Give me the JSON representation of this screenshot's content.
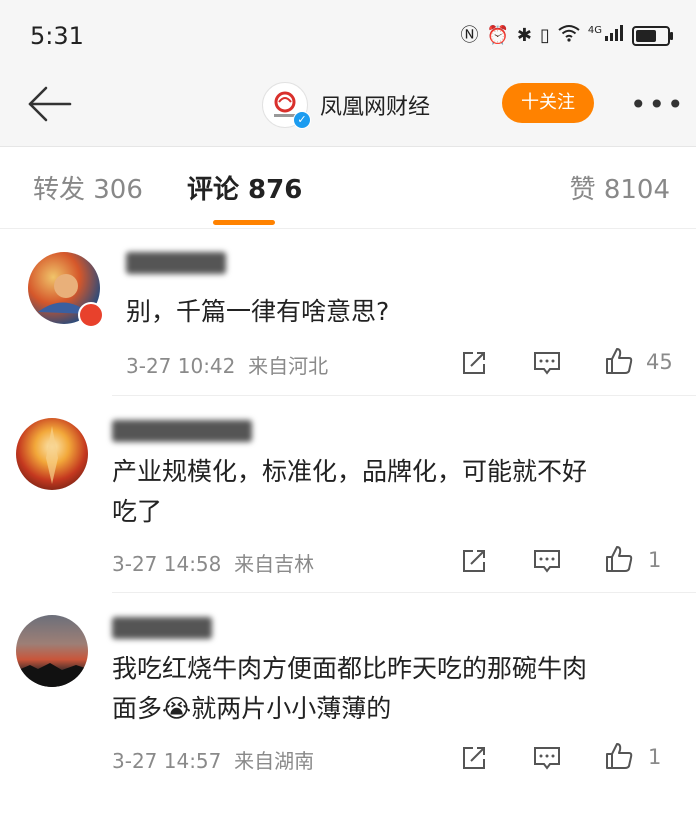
{
  "status_bar": {
    "time": "5:31",
    "network": "4G",
    "icons": [
      "nfc-icon",
      "alarm-icon",
      "bluetooth-icon",
      "vibrate-icon",
      "wifi-icon",
      "signal-icon",
      "battery-icon"
    ]
  },
  "nav": {
    "account_name": "凤凰网财经",
    "follow_label": "十关注",
    "more_label": "•••"
  },
  "tabs": [
    {
      "label": "转发 306"
    },
    {
      "label": "评论 876"
    },
    {
      "label": "赞 8104"
    }
  ],
  "comments": [
    {
      "text": "别，千篇一律有啥意思?",
      "meta": "3-27 10:42  来自河北",
      "likes": "45"
    },
    {
      "text_line1": "产业规模化，标准化，品牌化，可能就不好",
      "text_line2": "吃了",
      "meta": "3-27 14:58  来自吉林",
      "likes": "1"
    },
    {
      "text_line1": "我吃红烧牛肉方便面都比昨天吃的那碗牛肉",
      "text_line2": "面多😭就两片小小薄薄的",
      "meta": "3-27 14:57  来自湖南",
      "likes": "1"
    }
  ],
  "colors": {
    "accent": "#ff8200",
    "verify": "#1c9cf0",
    "meta": "#8a8a8a"
  }
}
